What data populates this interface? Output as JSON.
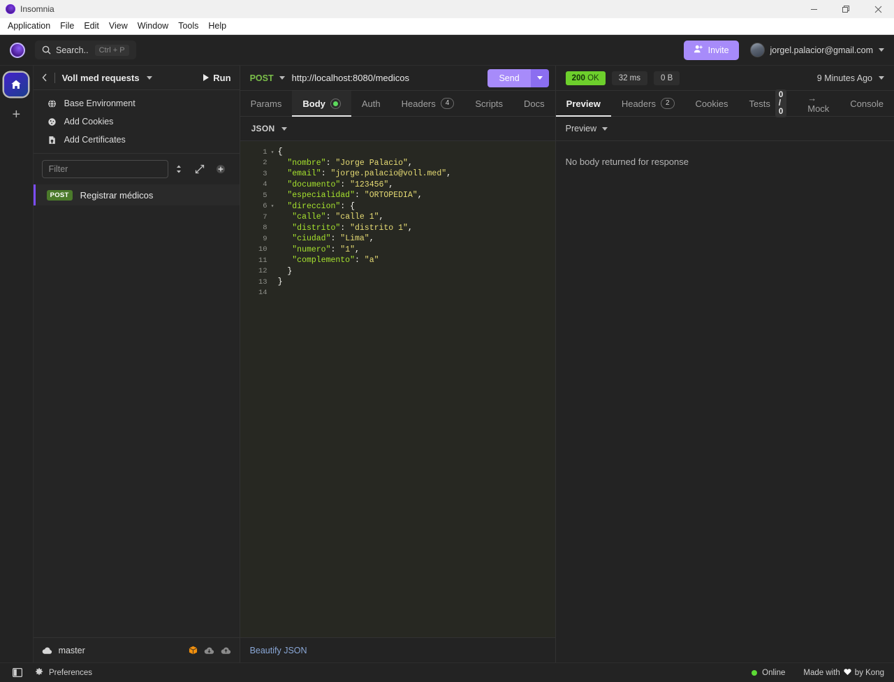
{
  "window": {
    "app_title": "Insomnia",
    "app_icon": "insomnia-logo-icon",
    "minimize_icon": "minimize-icon",
    "maximize_icon": "maximize-icon",
    "close_icon": "close-icon"
  },
  "menubar": {
    "items": [
      {
        "label": "Application"
      },
      {
        "label": "File"
      },
      {
        "label": "Edit"
      },
      {
        "label": "View"
      },
      {
        "label": "Window"
      },
      {
        "label": "Tools"
      },
      {
        "label": "Help"
      }
    ]
  },
  "topbar": {
    "logo_icon": "insomnia-logo-icon",
    "search": {
      "icon": "search-icon",
      "label": "Search..",
      "shortcut": "Ctrl + P"
    },
    "invite": {
      "icon": "user-plus-icon",
      "label": "Invite"
    },
    "account": {
      "avatar_icon": "user-avatar",
      "email": "jorgel.palacior@gmail.com",
      "caret_icon": "chevron-down-icon"
    }
  },
  "rail": {
    "home_icon": "home-icon",
    "add_icon": "plus-icon"
  },
  "sidebar": {
    "header": {
      "back_icon": "chevron-left-icon",
      "workspace": "Voll med requests",
      "workspace_caret_icon": "chevron-down-icon",
      "run_label": "Run",
      "run_icon": "play-icon"
    },
    "env_items": [
      {
        "icon": "globe-icon",
        "label": "Base Environment"
      },
      {
        "icon": "cookie-icon",
        "label": "Add Cookies"
      },
      {
        "icon": "certificate-icon",
        "label": "Add Certificates"
      }
    ],
    "filter": {
      "placeholder": "Filter",
      "value": "",
      "sort_icon": "sort-icon",
      "expand_icon": "expand-icon",
      "add_icon": "plus-circle-icon"
    },
    "requests": [
      {
        "method": "POST",
        "name": "Registrar médicos",
        "selected": true
      }
    ],
    "git": {
      "cloud_icon": "cloud-icon",
      "branch": "master",
      "package_icon": "package-icon",
      "pull_icon": "cloud-download-icon",
      "push_icon": "cloud-upload-icon"
    }
  },
  "request": {
    "method": "POST",
    "method_caret_icon": "chevron-down-icon",
    "url": "http://localhost:8080/medicos",
    "send_label": "Send",
    "send_caret_icon": "chevron-down-icon",
    "tabs": [
      {
        "label": "Params",
        "active": false
      },
      {
        "label": "Body",
        "active": true,
        "indicator": "green-dot"
      },
      {
        "label": "Auth",
        "active": false
      },
      {
        "label": "Headers",
        "active": false,
        "count": "4"
      },
      {
        "label": "Scripts",
        "active": false
      },
      {
        "label": "Docs",
        "active": false
      }
    ],
    "format": {
      "label": "JSON",
      "caret_icon": "chevron-down-icon"
    },
    "beautify_label": "Beautify JSON",
    "body_lines": [
      {
        "num": "1",
        "fold": true,
        "tokens": [
          {
            "t": "punc",
            "v": "{"
          }
        ]
      },
      {
        "num": "2",
        "fold": false,
        "tokens": [
          {
            "t": "key",
            "v": "  \"nombre\""
          },
          {
            "t": "punc",
            "v": ": "
          },
          {
            "t": "str",
            "v": "\"Jorge Palacio\""
          },
          {
            "t": "punc",
            "v": ","
          }
        ]
      },
      {
        "num": "3",
        "fold": false,
        "tokens": [
          {
            "t": "key",
            "v": "  \"email\""
          },
          {
            "t": "punc",
            "v": ": "
          },
          {
            "t": "str",
            "v": "\"jorge.palacio@voll.med\""
          },
          {
            "t": "punc",
            "v": ","
          }
        ]
      },
      {
        "num": "4",
        "fold": false,
        "tokens": [
          {
            "t": "key",
            "v": "  \"documento\""
          },
          {
            "t": "punc",
            "v": ": "
          },
          {
            "t": "str",
            "v": "\"123456\""
          },
          {
            "t": "punc",
            "v": ","
          }
        ]
      },
      {
        "num": "5",
        "fold": false,
        "tokens": [
          {
            "t": "key",
            "v": "  \"especialidad\""
          },
          {
            "t": "punc",
            "v": ": "
          },
          {
            "t": "str",
            "v": "\"ORTOPEDIA\""
          },
          {
            "t": "punc",
            "v": ","
          }
        ]
      },
      {
        "num": "6",
        "fold": true,
        "tokens": [
          {
            "t": "key",
            "v": "  \"direccion\""
          },
          {
            "t": "punc",
            "v": ": {"
          }
        ]
      },
      {
        "num": "7",
        "fold": false,
        "tokens": [
          {
            "t": "key",
            "v": "   \"calle\""
          },
          {
            "t": "punc",
            "v": ": "
          },
          {
            "t": "str",
            "v": "\"calle 1\""
          },
          {
            "t": "punc",
            "v": ","
          }
        ]
      },
      {
        "num": "8",
        "fold": false,
        "tokens": [
          {
            "t": "key",
            "v": "   \"distrito\""
          },
          {
            "t": "punc",
            "v": ": "
          },
          {
            "t": "str",
            "v": "\"distrito 1\""
          },
          {
            "t": "punc",
            "v": ","
          }
        ]
      },
      {
        "num": "9",
        "fold": false,
        "tokens": [
          {
            "t": "key",
            "v": "   \"ciudad\""
          },
          {
            "t": "punc",
            "v": ": "
          },
          {
            "t": "str",
            "v": "\"Lima\""
          },
          {
            "t": "punc",
            "v": ","
          }
        ]
      },
      {
        "num": "10",
        "fold": false,
        "tokens": [
          {
            "t": "key",
            "v": "   \"numero\""
          },
          {
            "t": "punc",
            "v": ": "
          },
          {
            "t": "str",
            "v": "\"1\""
          },
          {
            "t": "punc",
            "v": ","
          }
        ]
      },
      {
        "num": "11",
        "fold": false,
        "tokens": [
          {
            "t": "key",
            "v": "   \"complemento\""
          },
          {
            "t": "punc",
            "v": ": "
          },
          {
            "t": "str",
            "v": "\"a\""
          }
        ]
      },
      {
        "num": "12",
        "fold": false,
        "tokens": [
          {
            "t": "punc",
            "v": "  }"
          }
        ]
      },
      {
        "num": "13",
        "fold": false,
        "tokens": [
          {
            "t": "punc",
            "v": "}"
          }
        ]
      },
      {
        "num": "14",
        "fold": false,
        "tokens": []
      }
    ]
  },
  "response": {
    "status_code": "200",
    "status_text": "OK",
    "time": "32 ms",
    "size": "0 B",
    "timestamp": "9 Minutes Ago",
    "timestamp_caret_icon": "chevron-down-icon",
    "tabs": [
      {
        "label": "Preview",
        "active": true
      },
      {
        "label": "Headers",
        "active": false,
        "count": "2"
      },
      {
        "label": "Cookies",
        "active": false
      },
      {
        "label": "Tests",
        "active": false,
        "score": "0 / 0"
      },
      {
        "label": "→ Mock",
        "active": false
      },
      {
        "label": "Console",
        "active": false
      }
    ],
    "preview_mode": "Preview",
    "preview_caret_icon": "chevron-down-icon",
    "empty_message": "No body returned for response"
  },
  "statusbar": {
    "panel_toggle_icon": "panel-toggle-icon",
    "preferences_icon": "gear-icon",
    "preferences_label": "Preferences",
    "online_label": "Online",
    "made_with_prefix": "Made with",
    "heart_icon": "heart-icon",
    "made_with_suffix": "by Kong"
  },
  "colors": {
    "accent": "#a78bfa",
    "success": "#6dcf2c",
    "method_post": "#4b7a2b",
    "selection_bar": "#7c4dff"
  }
}
